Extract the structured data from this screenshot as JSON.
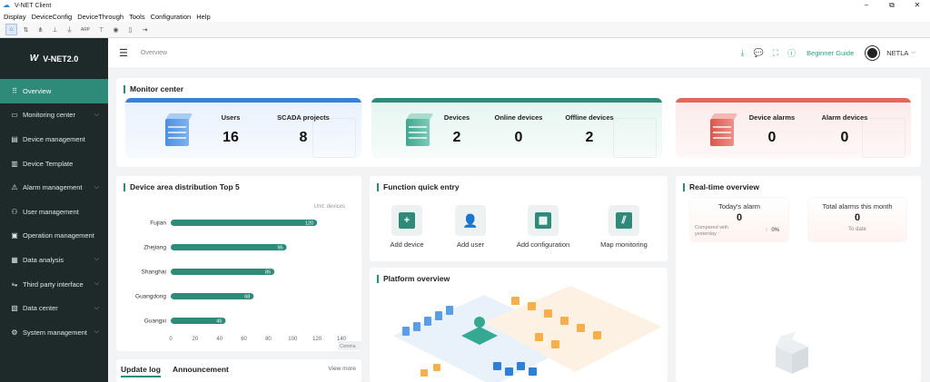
{
  "window": {
    "title": "V-NET Client",
    "minimize": "–",
    "maximize": "⧉",
    "close": "✕"
  },
  "menu": [
    "Display",
    "DeviceConfig",
    "DeviceThrough",
    "Tools",
    "Configuration",
    "Help"
  ],
  "toolbar": {
    "arp_label": "ARP"
  },
  "sidebar": {
    "brand": "V-NET2.0",
    "items": [
      {
        "label": "Overview",
        "icon": "grid-icon",
        "active": true,
        "expandable": false
      },
      {
        "label": "Monitoring center",
        "icon": "monitor-icon",
        "expandable": true
      },
      {
        "label": "Device management",
        "icon": "device-icon",
        "expandable": false
      },
      {
        "label": "Device Template",
        "icon": "template-icon",
        "expandable": false
      },
      {
        "label": "Alarm management",
        "icon": "alarm-icon",
        "expandable": true
      },
      {
        "label": "User management",
        "icon": "user-icon",
        "expandable": false
      },
      {
        "label": "Operation management",
        "icon": "operation-icon",
        "expandable": false
      },
      {
        "label": "Data analysis",
        "icon": "analysis-icon",
        "expandable": true
      },
      {
        "label": "Third party interface",
        "icon": "interface-icon",
        "expandable": true
      },
      {
        "label": "Data center",
        "icon": "datacenter-icon",
        "expandable": true
      },
      {
        "label": "System management",
        "icon": "system-icon",
        "expandable": true
      }
    ]
  },
  "header": {
    "breadcrumb": "Overview",
    "guide": "Beginner Guide",
    "username": "NETLA",
    "icons": [
      "download-icon",
      "chat-icon",
      "fullscreen-icon",
      "info-icon"
    ]
  },
  "monitor": {
    "title": "Monitor center",
    "groups": [
      {
        "color": "#3b82d6",
        "stats": [
          {
            "label": "Users",
            "value": "16"
          },
          {
            "label": "SCADA projects",
            "value": "8"
          }
        ]
      },
      {
        "color": "#2e8b7a",
        "stats": [
          {
            "label": "Devices",
            "value": "2"
          },
          {
            "label": "Online devices",
            "value": "0"
          },
          {
            "label": "Offline devices",
            "value": "2"
          }
        ]
      },
      {
        "color": "#e0685c",
        "stats": [
          {
            "label": "Device alarms",
            "value": "0"
          },
          {
            "label": "Alarm devices",
            "value": "0"
          }
        ]
      }
    ]
  },
  "distribution": {
    "title": "Device area distribution Top 5",
    "unit": "Unit: devices",
    "watermark": "Comma"
  },
  "chart_data": {
    "type": "bar",
    "orientation": "horizontal",
    "categories": [
      "Fujian",
      "Zhejiang",
      "Shanghai",
      "Guangdong",
      "Guangxi"
    ],
    "values": [
      120,
      95,
      85,
      68,
      45
    ],
    "xlim": [
      0,
      140
    ],
    "xticks": [
      0,
      20,
      40,
      60,
      80,
      100,
      120,
      140
    ],
    "bar_color": "#2e8b7a",
    "unit": "Unit: devices"
  },
  "quick": {
    "title": "Function quick entry",
    "items": [
      {
        "label": "Add device",
        "glyph": "+"
      },
      {
        "label": "Add user",
        "glyph": "👤"
      },
      {
        "label": "Add configuration",
        "glyph": "▦"
      },
      {
        "label": "Map monitoring",
        "glyph": "⫽"
      }
    ]
  },
  "platform": {
    "title": "Platform overview"
  },
  "realtime": {
    "title": "Real-time overview",
    "today_label": "Today's alarm",
    "today_value": "0",
    "compared_label": "Compared with yesterday :",
    "compared_value": "0%",
    "month_label": "Total alarms this month",
    "month_value": "0",
    "month_sub": "To date"
  },
  "updates": {
    "tab1": "Update log",
    "tab2": "Announcement",
    "view_more": "View more"
  },
  "colors": {
    "accent": "#2e8b7a",
    "sidebar_bg": "#1e2a2a",
    "blue": "#3b82d6",
    "red": "#e0685c"
  }
}
